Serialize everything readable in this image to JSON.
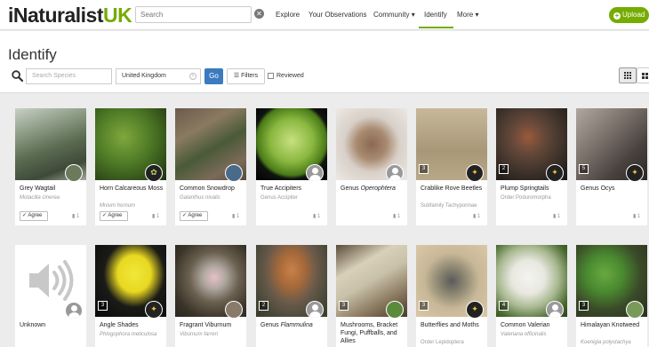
{
  "app": {
    "logo_prefix": "iNaturalist",
    "logo_suffix": "UK"
  },
  "search": {
    "placeholder": "Search"
  },
  "nav": {
    "explore": "Explore",
    "your_observations": "Your Observations",
    "community": "Community",
    "identify": "Identify",
    "more": "More",
    "upload": "Upload"
  },
  "header": {
    "title": "Identify",
    "species_placeholder": "Search Species",
    "place_value": "United Kingdom",
    "go": "Go",
    "filters": "Filters",
    "reviewed": "Reviewed"
  },
  "colors": {
    "brand_green": "#74ac00",
    "go_blue": "#3b7bbf"
  },
  "cards": [
    {
      "common": "Grey Wagtail",
      "sci": "Motacilla cinerea",
      "agree": "Agree",
      "comments": "1",
      "icon": "user-photo"
    },
    {
      "common": "Horn Calcareous Moss",
      "sci": "Mnium hornum",
      "agree": "Agree",
      "comments": "1",
      "icon": "iconic-plant"
    },
    {
      "common": "Common Snowdrop",
      "sci": "Galanthus nivalis",
      "agree": "Agree",
      "comments": "1",
      "icon": "user-photo"
    },
    {
      "common": "True Accipiters",
      "sci": "Genus Accipiter",
      "comments": "1",
      "icon": "user-default"
    },
    {
      "common_prefix": "Genus ",
      "common_ital": "Operophtera",
      "comments": "1",
      "icon": "user-default"
    },
    {
      "common": "Crablike Rove Beetles",
      "sci": "Subfamily Tachyporinae",
      "badge": "3",
      "comments": "1",
      "icon": "iconic-insect"
    },
    {
      "common": "Plump Springtails",
      "sci": "Order Poduromorpha",
      "badge": "2",
      "comments": "1",
      "icon": "iconic-insect"
    },
    {
      "common": "Genus Ocys",
      "badge": "5",
      "comments": "1",
      "icon": "iconic-insect"
    },
    {
      "common": "Unknown",
      "icon": "user-default"
    },
    {
      "common": "Angle Shades",
      "sci": "Phlogophora meticulosa",
      "badge": "3",
      "icon": "iconic-insect"
    },
    {
      "common": "Fragrant Viburnum",
      "sci": "Viburnum farreri",
      "icon": "user-photo"
    },
    {
      "common_prefix": "Genus ",
      "common_ital": "Flammulina",
      "badge": "2",
      "icon": "user-default"
    },
    {
      "common": "Mushrooms, Bracket Fungi, Puffballs, and Allies",
      "badge": "3",
      "icon": "user-photo"
    },
    {
      "common": "Butterflies and Moths",
      "sci": "Order Lepidoptera",
      "badge": "3",
      "icon": "iconic-insect"
    },
    {
      "common": "Common Valerian",
      "sci": "Valeriana officinalis",
      "badge": "4",
      "icon": "user-default"
    },
    {
      "common": "Himalayan Knotweed",
      "sci": "Koenigia polystachya",
      "badge": "3",
      "icon": "user-photo"
    }
  ]
}
